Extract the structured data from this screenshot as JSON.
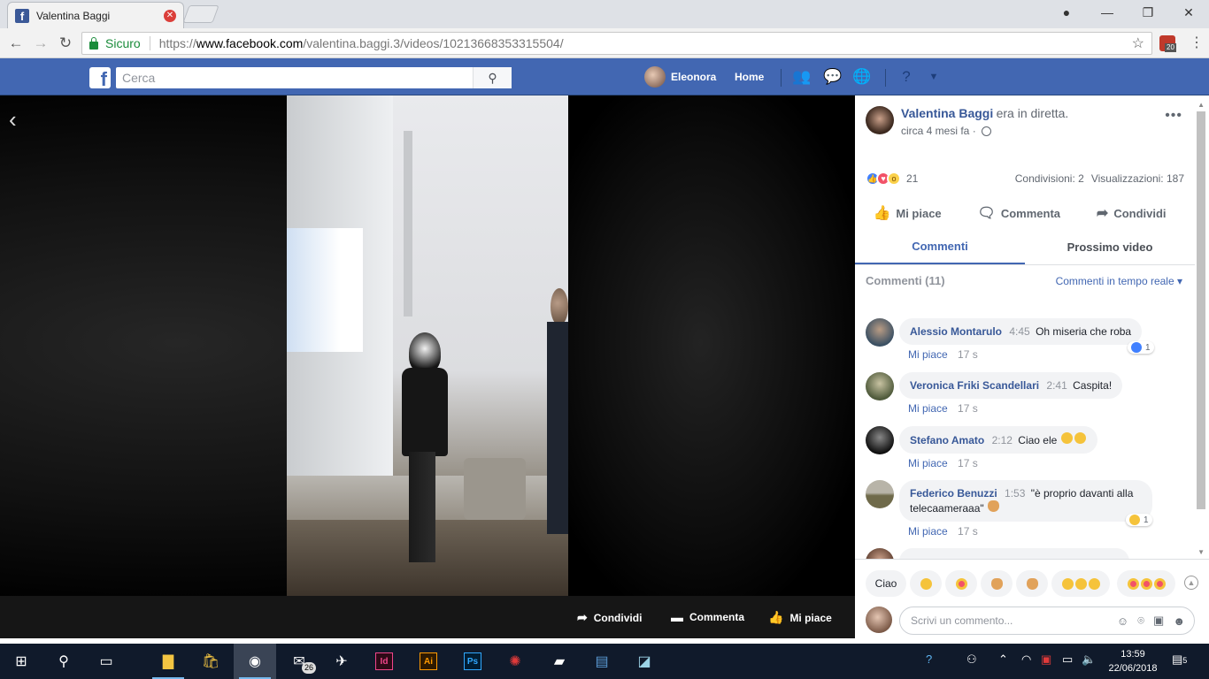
{
  "browser": {
    "tab_title": "Valentina Baggi",
    "secure_label": "Sicuro",
    "url_proto": "https://",
    "url_host": "www.facebook.com",
    "url_path": "/valentina.baggi.3/videos/10213668353315504/",
    "extension_badge": "20"
  },
  "fb_header": {
    "search_placeholder": "Cerca",
    "user_name": "Eleonora",
    "home_label": "Home"
  },
  "video_bar": {
    "share": "Condividi",
    "comment": "Commenta",
    "like": "Mi piace"
  },
  "post": {
    "author": "Valentina Baggi",
    "status": "era in diretta.",
    "time": "circa 4 mesi fa ·",
    "reactions_count": "21",
    "shares": "Condivisioni: 2",
    "views": "Visualizzazioni: 187",
    "actions": {
      "like": "Mi piace",
      "comment": "Commenta",
      "share": "Condividi"
    },
    "tabs": {
      "comments": "Commenti",
      "next": "Prossimo video"
    },
    "comments_title": "Commenti (11)",
    "realtime": "Commenti in tempo reale ▾"
  },
  "comments": [
    {
      "name": "Alessio Montarulo",
      "ts": "4:45",
      "text": "Oh miseria che roba",
      "like": "Mi piace",
      "ago": "17 s",
      "reaction_count": "1"
    },
    {
      "name": "Veronica Friki Scandellari",
      "ts": "2:41",
      "text": "Caspita!",
      "like": "Mi piace",
      "ago": "17 s"
    },
    {
      "name": "Stefano Amato",
      "ts": "2:12",
      "text": "Ciao ele",
      "like": "Mi piace",
      "ago": "17 s"
    },
    {
      "name": "Federico Benuzzi",
      "ts": "1:53",
      "text": "\"è proprio davanti alla telecaameraaa\"",
      "like": "Mi piace",
      "ago": "17 s",
      "reaction_count": "1"
    }
  ],
  "quick_replies": {
    "ciao": "Ciao"
  },
  "composer": {
    "placeholder": "Scrivi un commento..."
  },
  "taskbar": {
    "mail_badge": "26",
    "indesign": "Id",
    "illustrator": "Ai",
    "photoshop": "Ps",
    "time": "13:59",
    "date": "22/06/2018",
    "notif_count": "5"
  },
  "colors": {
    "fb_blue": "#4267b2",
    "link_blue": "#385898",
    "secure_green": "#1a8c3b"
  }
}
